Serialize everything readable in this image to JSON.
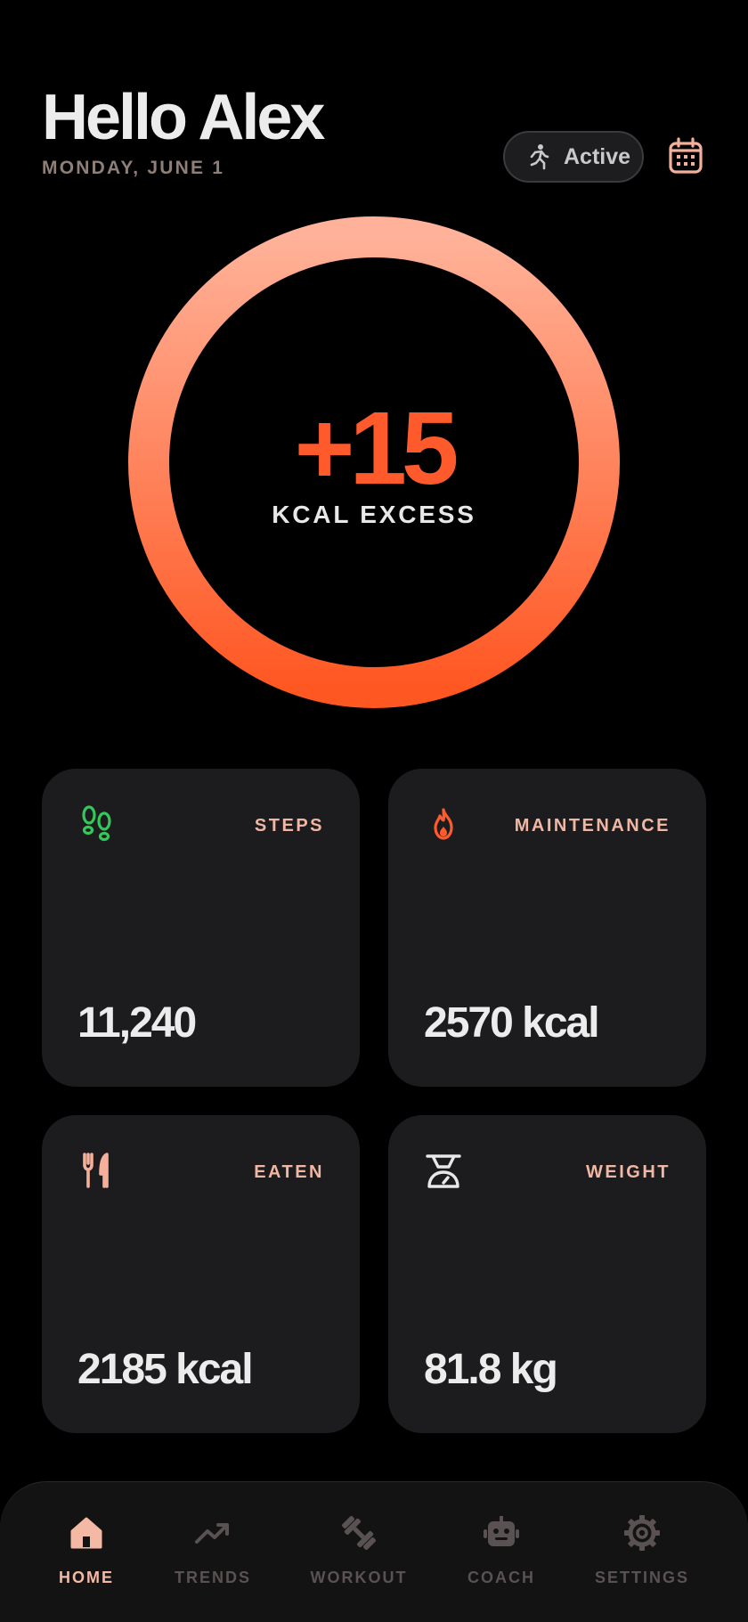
{
  "header": {
    "greeting": "Hello Alex",
    "date": "MONDAY, JUNE 1",
    "activity_label": "Active",
    "activity_icon": "running-icon",
    "calendar_icon": "calendar-icon"
  },
  "balance_ring": {
    "value": "+15",
    "label": "KCAL EXCESS",
    "gradient_top": "#ffb299",
    "gradient_bottom": "#ff5722",
    "value_color": "#ff5a2c"
  },
  "cards": {
    "steps": {
      "title": "STEPS",
      "value": "11,240",
      "icon": "footsteps-icon",
      "icon_color": "#34c759"
    },
    "maintenance": {
      "title": "MAINTENANCE",
      "value": "2570 kcal",
      "icon": "flame-icon",
      "icon_color": "#ff5a2c"
    },
    "eaten": {
      "title": "EATEN",
      "value": "2185 kcal",
      "icon": "fork-knife-icon",
      "icon_color": "#f4b09a"
    },
    "weight": {
      "title": "WEIGHT",
      "value": "81.8 kg",
      "icon": "scale-icon",
      "icon_color": "#e8e8e8"
    }
  },
  "tabbar": {
    "items": [
      {
        "label": "HOME",
        "icon": "home-icon",
        "active": true
      },
      {
        "label": "TRENDS",
        "icon": "trend-up-icon",
        "active": false
      },
      {
        "label": "WORKOUT",
        "icon": "dumbbell-icon",
        "active": false
      },
      {
        "label": "COACH",
        "icon": "robot-icon",
        "active": false
      },
      {
        "label": "SETTINGS",
        "icon": "gear-icon",
        "active": false
      }
    ],
    "active_color": "#f4b9a5",
    "inactive_color": "#5a5252"
  }
}
